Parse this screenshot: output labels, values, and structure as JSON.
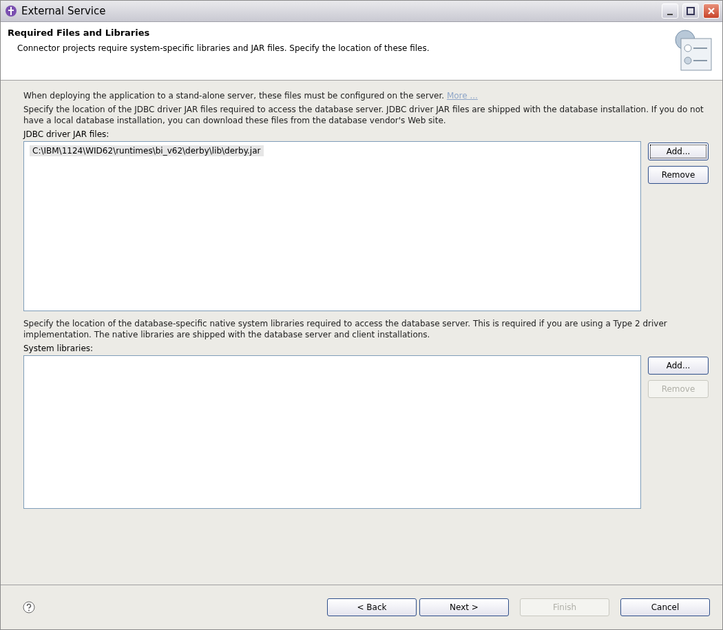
{
  "window": {
    "title": "External Service"
  },
  "header": {
    "title": "Required Files and Libraries",
    "description": "Connector projects require system-specific libraries and JAR files. Specify the location of these files."
  },
  "intro": {
    "text": "When deploying the application to a stand-alone server, these files must be configured on the server.",
    "link": "More ..."
  },
  "sections": [
    {
      "description": "Specify the location of the JDBC driver JAR files required to access the database server. JDBC driver JAR files are shipped with the database installation. If you do not have a local database installation, you can download these files from the database vendor's Web site.",
      "label": "JDBC driver JAR files:",
      "items": [
        {
          "text": "C:\\IBM\\1124\\WID62\\runtimes\\bi_v62\\derby\\lib\\derby.jar",
          "selected": true
        }
      ],
      "buttons": [
        {
          "label": "Add...",
          "disabled": false,
          "focused": true
        },
        {
          "label": "Remove",
          "disabled": false,
          "focused": false
        }
      ]
    },
    {
      "description": "Specify the location of the database-specific native system libraries required to access the database server. This is required if you are using a Type 2 driver implementation. The native libraries are shipped with the database server and client installations.",
      "label": "System libraries:",
      "buttons": [
        {
          "label": "Add...",
          "disabled": false,
          "focused": false
        },
        {
          "label": "Remove",
          "disabled": true,
          "focused": false
        }
      ]
    }
  ],
  "footer": {
    "buttons": [
      {
        "label": "< Back",
        "disabled": false
      },
      {
        "label": "Next >",
        "disabled": false
      },
      {
        "label": "Finish",
        "disabled": true
      },
      {
        "label": "Cancel",
        "disabled": false
      }
    ]
  }
}
